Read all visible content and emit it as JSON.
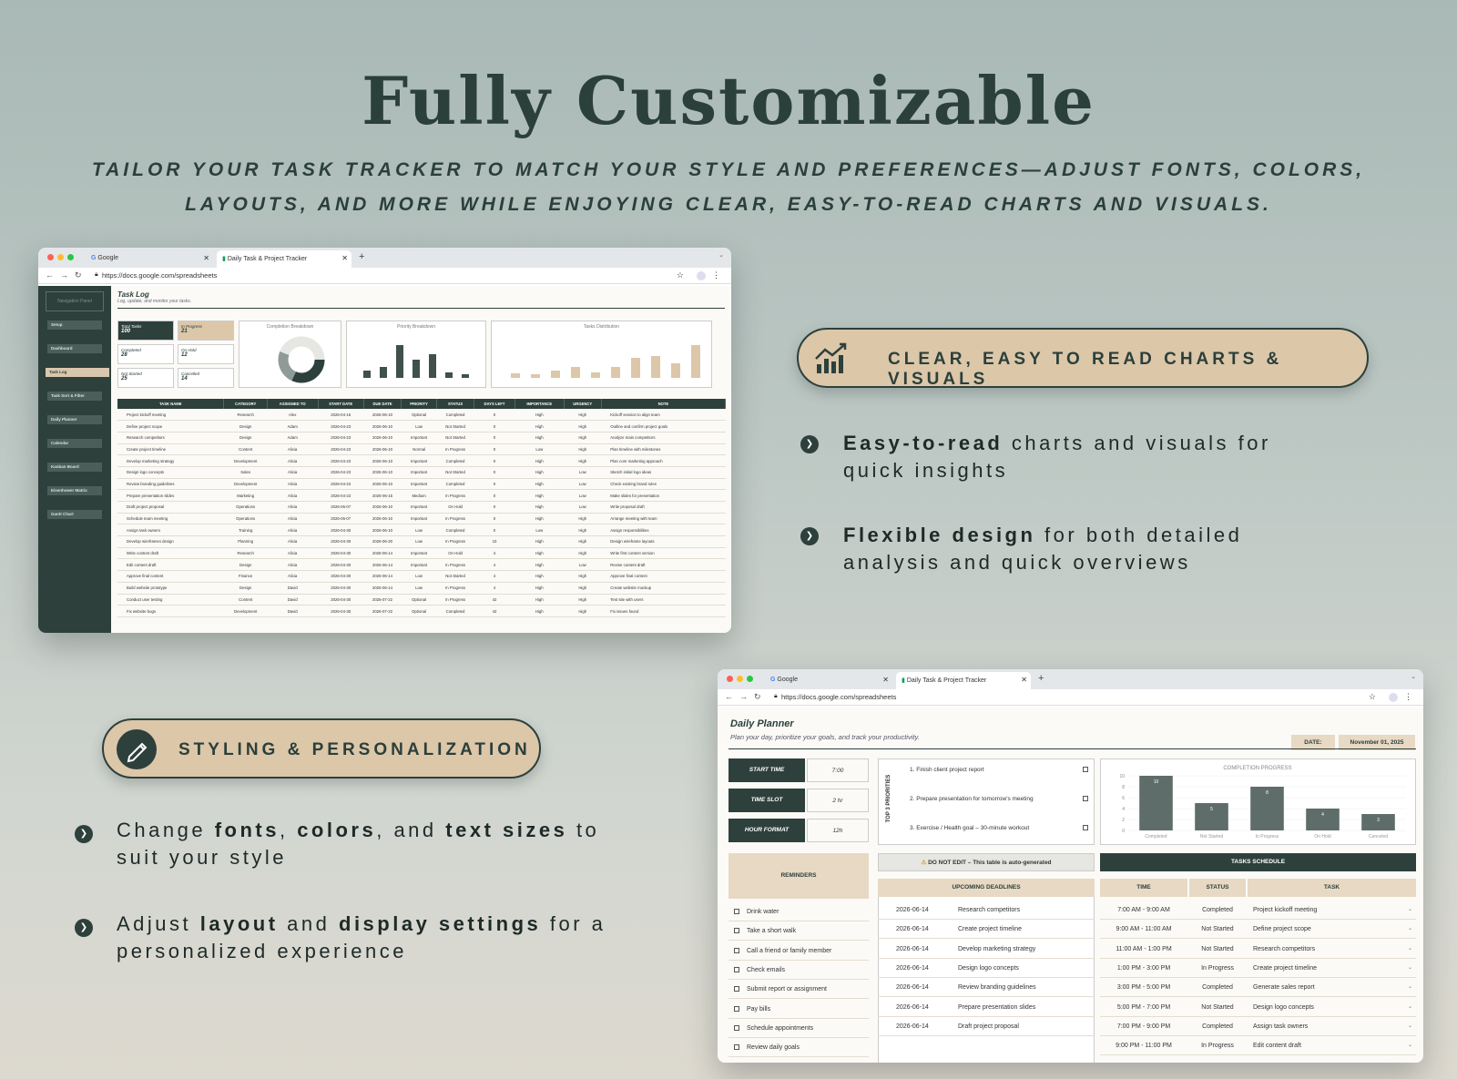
{
  "header": {
    "title": "Fully Customizable",
    "subtitle_line1": "TAILOR YOUR TASK TRACKER TO MATCH YOUR STYLE AND PREFERENCES—ADJUST FONTS, COLORS,",
    "subtitle_line2": "LAYOUTS, AND MORE WHILE ENJOYING CLEAR, EASY-TO-READ CHARTS AND VISUALS."
  },
  "browser": {
    "tab1": "Google",
    "tab2": "Daily Task & Project Tracker",
    "url": "https://docs.google.com/spreadsheets"
  },
  "task_log": {
    "nav_title": "Navigation Panel",
    "nav_items": [
      "Setup",
      "Dashboard",
      "Task Log",
      "Task Sort & Filter",
      "Daily Planner",
      "Calendar",
      "Kanban Board",
      "Eisenhower Matrix",
      "Gantt Chart"
    ],
    "title": "Task Log",
    "subtitle": "Log, update, and monitor your tasks.",
    "stats": [
      {
        "label": "Total Tasks",
        "value": "100"
      },
      {
        "label": "In Progress",
        "value": "21"
      },
      {
        "label": "Completed",
        "value": "28"
      },
      {
        "label": "On Hold",
        "value": "12"
      },
      {
        "label": "Not Started",
        "value": "25"
      },
      {
        "label": "Cancelled",
        "value": "14"
      }
    ],
    "panel1": "Completion Breakdown",
    "panel2": "Priority Breakdown",
    "panel3": "Tasks Distribution",
    "columns": [
      "TASK NAME",
      "CATEGORY",
      "ASSIGNED TO",
      "START DATE",
      "DUE DATE",
      "PRIORITY",
      "STATUS",
      "DAYS LEFT",
      "IMPORTANCE",
      "URGENCY",
      "NOTE"
    ],
    "rows": [
      [
        "Project kickoff meeting",
        "Research",
        "Alex",
        "2026-04-16",
        "2026-06-10",
        "Optional",
        "Completed",
        "0",
        "High",
        "High",
        "Kickoff session to align team"
      ],
      [
        "Define project scope",
        "Design",
        "Adam",
        "2026-04-23",
        "2026-06-10",
        "Low",
        "Not Started",
        "0",
        "High",
        "High",
        "Outline and confirm project goals"
      ],
      [
        "Research competitors",
        "Design",
        "Adam",
        "2026-04-23",
        "2026-06-10",
        "Important",
        "Not Started",
        "0",
        "High",
        "High",
        "Analyze main competitors"
      ],
      [
        "Create project timeline",
        "Content",
        "Alicia",
        "2026-04-23",
        "2026-06-10",
        "Normal",
        "In Progress",
        "0",
        "Low",
        "High",
        "Plan timeline with milestones"
      ],
      [
        "Develop marketing strategy",
        "Development",
        "Alicia",
        "2026-04-23",
        "2026-06-10",
        "Important",
        "Completed",
        "0",
        "High",
        "High",
        "Plan core marketing approach"
      ],
      [
        "Design logo concepts",
        "Sales",
        "Alicia",
        "2026-04-23",
        "2026-06-10",
        "Important",
        "Not Started",
        "0",
        "High",
        "Low",
        "Sketch initial logo ideas"
      ],
      [
        "Review branding guidelines",
        "Development",
        "Alicia",
        "2026-04-23",
        "2026-06-10",
        "Important",
        "Completed",
        "0",
        "High",
        "Low",
        "Check existing brand rules"
      ],
      [
        "Prepare presentation slides",
        "Marketing",
        "Alicia",
        "2026-04-23",
        "2026-06-15",
        "Medium",
        "In Progress",
        "0",
        "High",
        "Low",
        "Make slides for presentation"
      ],
      [
        "Draft project proposal",
        "Operations",
        "Alicia",
        "2026-05-07",
        "2026-06-10",
        "Important",
        "On Hold",
        "0",
        "High",
        "Low",
        "Write proposal draft"
      ],
      [
        "Schedule team meeting",
        "Operations",
        "Alicia",
        "2026-05-07",
        "2026-06-10",
        "Important",
        "In Progress",
        "0",
        "High",
        "High",
        "Arrange meeting with team"
      ],
      [
        "Assign task owners",
        "Training",
        "Alicia",
        "2026-04-30",
        "2026-06-10",
        "Low",
        "Completed",
        "0",
        "Low",
        "High",
        "Assign responsibilities"
      ],
      [
        "Develop wireframes design",
        "Planning",
        "Alicia",
        "2026-04-30",
        "2026-06-20",
        "Low",
        "In Progress",
        "10",
        "High",
        "High",
        "Design wireframe layouts"
      ],
      [
        "Write content draft",
        "Research",
        "Alicia",
        "2026-04-30",
        "2026-06-14",
        "Important",
        "On Hold",
        "4",
        "High",
        "High",
        "Write first content version"
      ],
      [
        "Edit content draft",
        "Design",
        "Alicia",
        "2026-04-30",
        "2026-06-14",
        "Important",
        "In Progress",
        "4",
        "High",
        "Low",
        "Revise content draft"
      ],
      [
        "Approve final content",
        "Finance",
        "Alicia",
        "2026-04-30",
        "2026-06-14",
        "Low",
        "Not Started",
        "4",
        "High",
        "High",
        "Approve final content"
      ],
      [
        "Build website prototype",
        "Design",
        "David",
        "2026-04-30",
        "2026-06-14",
        "Low",
        "In Progress",
        "4",
        "High",
        "High",
        "Create website mockup"
      ],
      [
        "Conduct user testing",
        "Content",
        "David",
        "2026-04-30",
        "2026-07-22",
        "Optional",
        "In Progress",
        "42",
        "High",
        "High",
        "Test site with users"
      ],
      [
        "Fix website bugs",
        "Development",
        "David",
        "2026-04-30",
        "2026-07-22",
        "Optional",
        "Completed",
        "42",
        "High",
        "High",
        "Fix issues found"
      ]
    ]
  },
  "badge_charts": "CLEAR, EASY TO READ CHARTS & VISUALS",
  "bullets_right": [
    {
      "bold": "Easy-to-read",
      "rest": " charts and visuals for",
      "line2": "quick insights"
    },
    {
      "bold": "Flexible design",
      "rest": " for both detailed",
      "line2": "analysis and quick overviews"
    }
  ],
  "badge_styling": "STYLING & PERSONALIZATION",
  "bullets_left": {
    "b1_pre": "Change ",
    "b1_fonts": "fonts",
    "b1_comma1": ", ",
    "b1_colors": "colors",
    "b1_and": ", and ",
    "b1_sizes": "text sizes",
    "b1_to": " to",
    "b1_line2": "suit your style",
    "b2_pre": "Adjust ",
    "b2_layout": "layout",
    "b2_and": " and ",
    "b2_display": "display settings",
    "b2_post": " for a",
    "b2_line2": "personalized experience"
  },
  "planner": {
    "title": "Daily Planner",
    "subtitle": "Plan your day, prioritize your goals, and track your productivity.",
    "date_label": "DATE:",
    "date_value": "November 01, 2025",
    "settings": [
      {
        "label": "START TIME",
        "value": "7:00"
      },
      {
        "label": "TIME SLOT",
        "value": "2 hr"
      },
      {
        "label": "HOUR FORMAT",
        "value": "12h"
      }
    ],
    "priorities_label": "TOP 3 PRIORITIES",
    "priorities": [
      "1. Finish client project report",
      "2. Prepare presentation for tomorrow's meeting",
      "3. Exercise / Health goal – 30-minute workout"
    ],
    "notice": "DO NOT EDIT – This table is auto-generated",
    "schedule_header": "TASKS SCHEDULE",
    "reminders_header": "REMINDERS",
    "reminders": [
      "Drink water",
      "Take a short walk",
      "Call a friend or family member",
      "Check emails",
      "Submit report or assignment",
      "Pay bills",
      "Schedule appointments",
      "Review daily goals"
    ],
    "deadlines_header": "UPCOMING DEADLINES",
    "deadlines": [
      [
        "2026-06-14",
        "Research competitors"
      ],
      [
        "2026-06-14",
        "Create project timeline"
      ],
      [
        "2026-06-14",
        "Develop marketing strategy"
      ],
      [
        "2026-06-14",
        "Design logo concepts"
      ],
      [
        "2026-06-14",
        "Review branding guidelines"
      ],
      [
        "2026-06-14",
        "Prepare presentation slides"
      ],
      [
        "2026-06-14",
        "Draft project proposal"
      ]
    ],
    "schedule_cols": [
      "TIME",
      "STATUS",
      "TASK"
    ],
    "schedule": [
      [
        "7:00 AM - 9:00 AM",
        "Completed",
        "Project kickoff meeting"
      ],
      [
        "9:00 AM - 11:00 AM",
        "Not Started",
        "Define project scope"
      ],
      [
        "11:00 AM - 1:00 PM",
        "Not Started",
        "Research competitors"
      ],
      [
        "1:00 PM - 3:00 PM",
        "In Progress",
        "Create project timeline"
      ],
      [
        "3:00 PM - 5:00 PM",
        "Completed",
        "Generate sales report"
      ],
      [
        "5:00 PM - 7:00 PM",
        "Not Started",
        "Design logo concepts"
      ],
      [
        "7:00 PM - 9:00 PM",
        "Completed",
        "Assign task owners"
      ],
      [
        "9:00 PM - 11:00 PM",
        "In Progress",
        "Edit content draft"
      ]
    ],
    "chart_title": "COMPLETION PROGRESS"
  },
  "chart_data": {
    "type": "bar",
    "title": "COMPLETION PROGRESS",
    "categories": [
      "Completed",
      "Not Started",
      "In Progress",
      "On Hold",
      "Canceled"
    ],
    "values": [
      10,
      5,
      8,
      4,
      3
    ],
    "ylim": [
      0,
      10
    ],
    "yticks": [
      "0",
      "2",
      "4",
      "6",
      "8",
      "10"
    ],
    "bar_color": "#5f6d6a"
  },
  "colors": {
    "dark": "#2d403c",
    "tan": "#dcc7a9"
  }
}
